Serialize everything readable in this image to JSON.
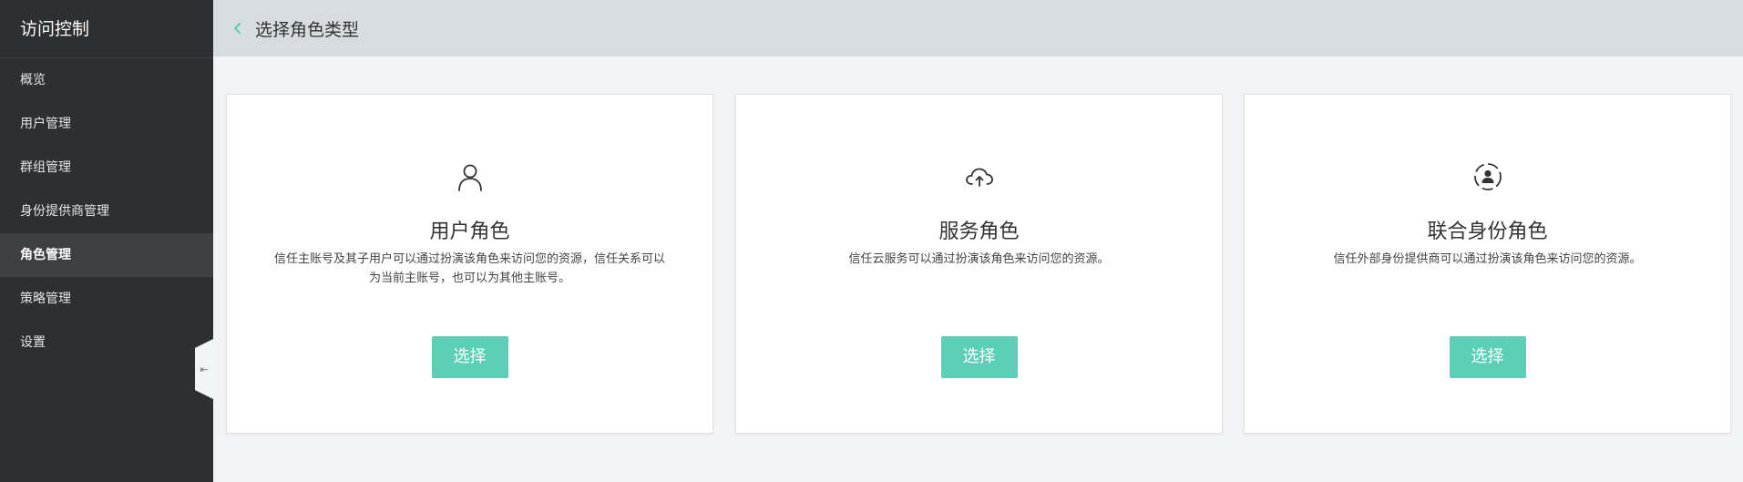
{
  "sidebar": {
    "title": "访问控制",
    "items": [
      {
        "label": "概览"
      },
      {
        "label": "用户管理"
      },
      {
        "label": "群组管理"
      },
      {
        "label": "身份提供商管理"
      },
      {
        "label": "角色管理"
      },
      {
        "label": "策略管理"
      },
      {
        "label": "设置"
      }
    ],
    "active_index": 4,
    "collapse_glyph": "⇤"
  },
  "header": {
    "title": "选择角色类型",
    "back_icon": "chevron-left-icon"
  },
  "cards": [
    {
      "icon": "user-icon",
      "title": "用户角色",
      "description": "信任主账号及其子用户可以通过扮演该角色来访问您的资源，信任关系可以为当前主账号，也可以为其他主账号。",
      "button_label": "选择"
    },
    {
      "icon": "cloud-upload-icon",
      "title": "服务角色",
      "description": "信任云服务可以通过扮演该角色来访问您的资源。",
      "button_label": "选择"
    },
    {
      "icon": "federated-identity-icon",
      "title": "联合身份角色",
      "description": "信任外部身份提供商可以通过扮演该角色来访问您的资源。",
      "button_label": "选择"
    }
  ],
  "colors": {
    "accent": "#5bd0b6",
    "sidebar_bg": "#2d2f31",
    "header_bg": "#d6dde0"
  }
}
